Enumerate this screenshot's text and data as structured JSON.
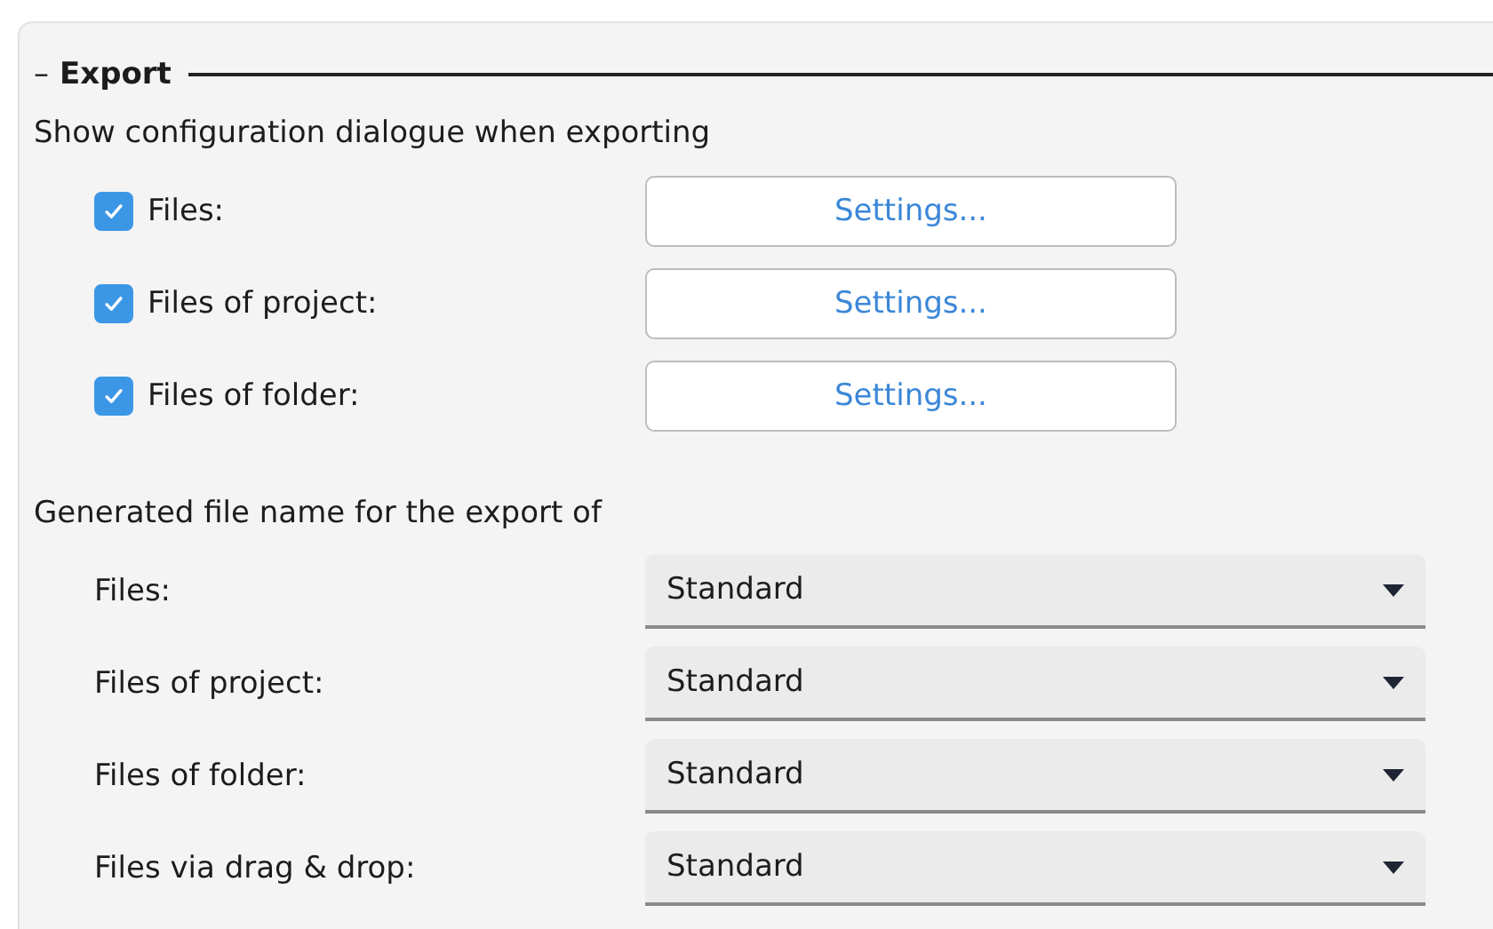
{
  "group": {
    "toggle": "–",
    "title": "Export"
  },
  "dialog_section": {
    "label": "Show configuration dialogue when exporting",
    "rows": [
      {
        "label": "Files:",
        "checked": true,
        "button": "Settings..."
      },
      {
        "label": "Files of project:",
        "checked": true,
        "button": "Settings..."
      },
      {
        "label": "Files of folder:",
        "checked": true,
        "button": "Settings..."
      }
    ]
  },
  "filename_section": {
    "label": "Generated file name for the export of",
    "rows": [
      {
        "label": "Files:",
        "value": "Standard"
      },
      {
        "label": "Files of project:",
        "value": "Standard"
      },
      {
        "label": "Files of folder:",
        "value": "Standard"
      },
      {
        "label": "Files via drag & drop:",
        "value": "Standard"
      }
    ]
  }
}
